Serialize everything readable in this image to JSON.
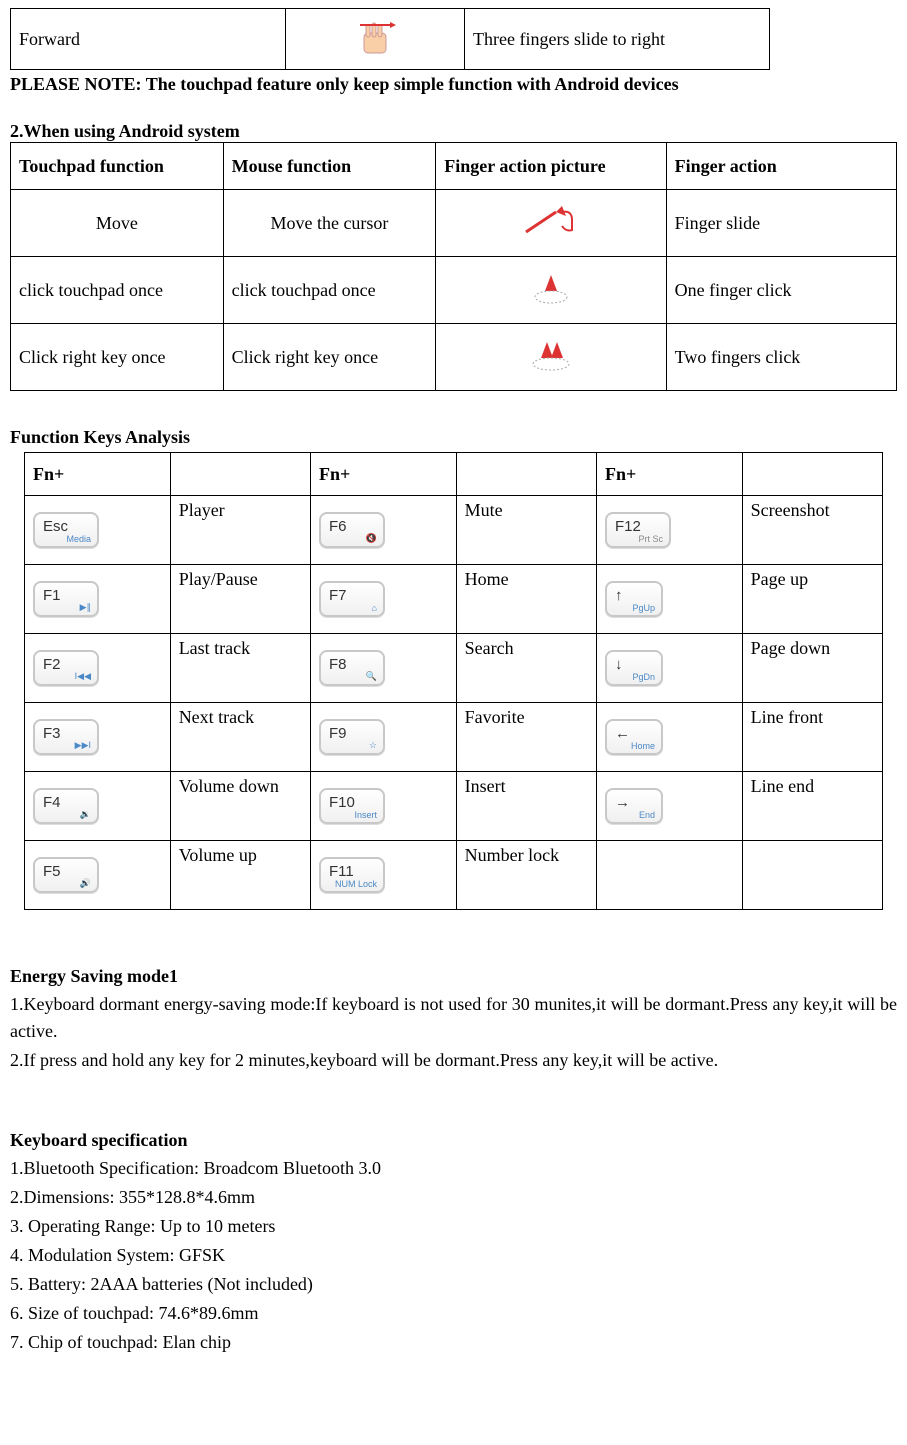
{
  "top_table": {
    "function": "Forward",
    "action": "Three fingers slide to right"
  },
  "note": "PLEASE NOTE: The touchpad feature only keep simple function with Android devices",
  "android": {
    "title": "2.When using Android system",
    "headers": {
      "c1": "Touchpad function",
      "c2": "Mouse function",
      "c3": "Finger action picture",
      "c4": "Finger action"
    },
    "rows": [
      {
        "c1": "Move",
        "c2": "Move the cursor",
        "c4": "Finger slide"
      },
      {
        "c1": "click touchpad once",
        "c2": "click touchpad once",
        "c4": "One finger click"
      },
      {
        "c1": "Click right key once",
        "c2": "Click right key once",
        "c4": "Two fingers click"
      }
    ]
  },
  "fn": {
    "title": "Function Keys Analysis",
    "header": "Fn+",
    "rows": [
      {
        "k1": "Esc",
        "s1": "Media",
        "l1": "Player",
        "k2": "F6",
        "s2": "🔇",
        "l2": "Mute",
        "k3": "F12",
        "s3": "Prt Sc",
        "l3": "Screenshot"
      },
      {
        "k1": "F1",
        "s1": "▶∥",
        "l1": "Play/Pause",
        "k2": "F7",
        "s2": "⌂",
        "l2": "Home",
        "k3": "↑",
        "s3": "PgUp",
        "l3": "Page up"
      },
      {
        "k1": "F2",
        "s1": "I◀◀",
        "l1": "Last track",
        "k2": "F8",
        "s2": "🔍",
        "l2": "Search",
        "k3": "↓",
        "s3": "PgDn",
        "l3": "Page down"
      },
      {
        "k1": "F3",
        "s1": "▶▶I",
        "l1": "Next track",
        "k2": "F9",
        "s2": "☆",
        "l2": "Favorite",
        "k3": "←",
        "s3": "Home",
        "l3": "Line front"
      },
      {
        "k1": "F4",
        "s1": "🔉",
        "l1": "Volume down",
        "k2": "F10",
        "s2": "Insert",
        "l2": "Insert",
        "k3": "→",
        "s3": "End",
        "l3": "Line end"
      },
      {
        "k1": "F5",
        "s1": "🔊",
        "l1": "Volume up",
        "k2": "F11",
        "s2": "NUM Lock",
        "l2": "Number lock",
        "k3": "",
        "s3": "",
        "l3": ""
      }
    ]
  },
  "energy": {
    "title": "Energy Saving mode1",
    "p1": "1.Keyboard dormant energy-saving mode:If keyboard is not used for 30 munites,it will be dormant.Press any key,it will be active.",
    "p2": "2.If press and hold any key for 2 minutes,keyboard will be dormant.Press any key,it will be active."
  },
  "spec": {
    "title": "Keyboard specification",
    "items": [
      "1.Bluetooth Specification: Broadcom Bluetooth 3.0",
      "2.Dimensions: 355*128.8*4.6mm",
      "3. Operating Range: Up to 10 meters",
      "4. Modulation System: GFSK",
      "5. Battery: 2AAA batteries (Not included)",
      "6. Size of touchpad: 74.6*89.6mm",
      "7. Chip of touchpad: Elan chip"
    ]
  }
}
